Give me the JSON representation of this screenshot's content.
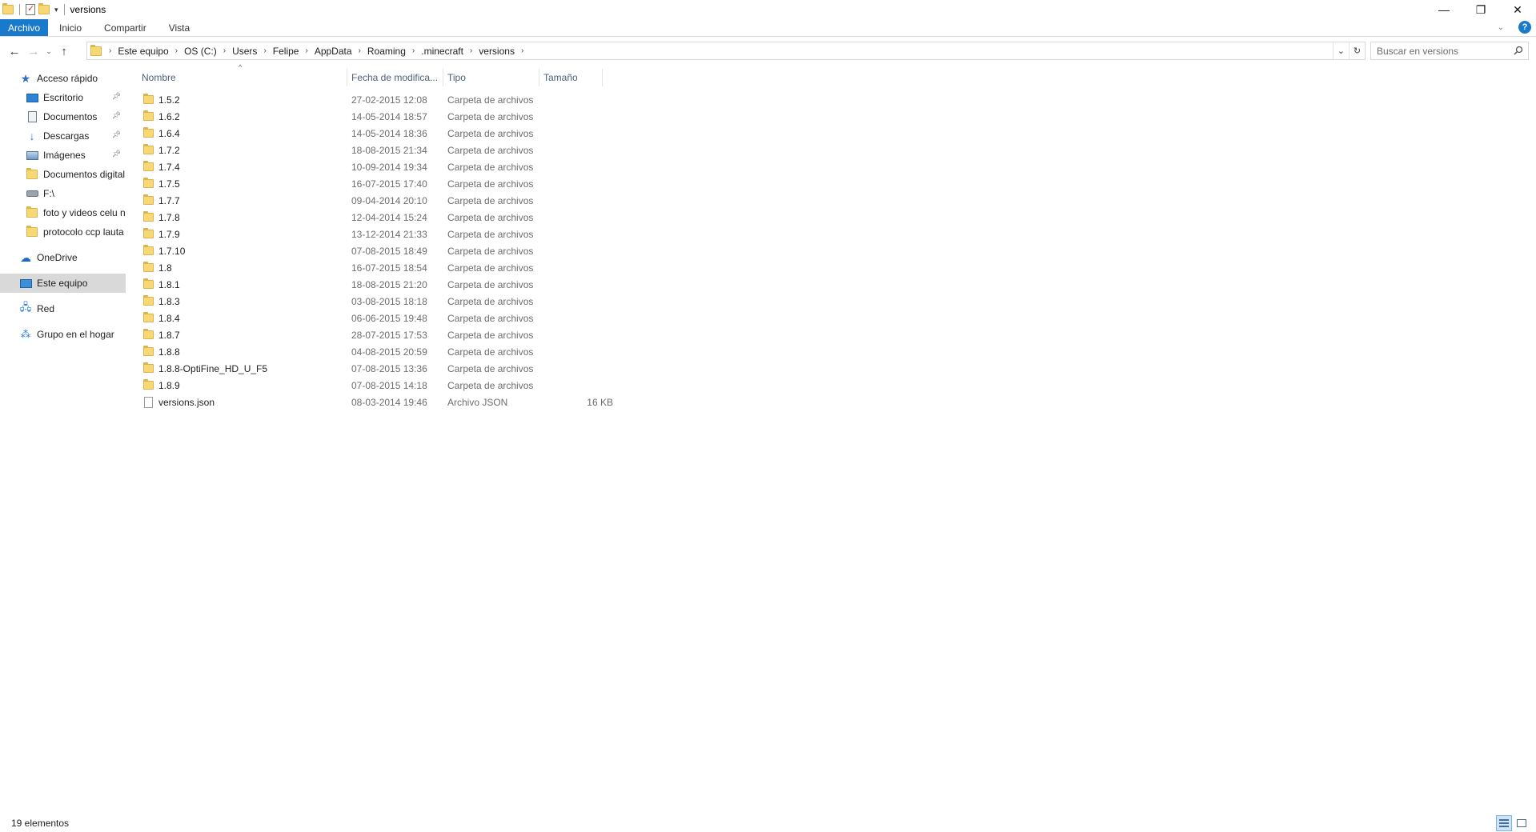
{
  "window": {
    "title": "versions",
    "controls": {
      "minimize": "—",
      "restore": "❐",
      "close": "✕"
    }
  },
  "ribbon": {
    "tabs": [
      "Archivo",
      "Inicio",
      "Compartir",
      "Vista"
    ],
    "help": "?"
  },
  "address": {
    "crumbs": [
      "Este equipo",
      "OS (C:)",
      "Users",
      "Felipe",
      "AppData",
      "Roaming",
      ".minecraft",
      "versions"
    ]
  },
  "search": {
    "placeholder": "Buscar en versions"
  },
  "sidebar": {
    "quick_access": "Acceso rápido",
    "quick_items": [
      {
        "label": "Escritorio",
        "icon": "desktop-icon",
        "pinned": true
      },
      {
        "label": "Documentos",
        "icon": "documents-icon",
        "pinned": true
      },
      {
        "label": "Descargas",
        "icon": "downloads-icon",
        "pinned": true
      },
      {
        "label": "Imágenes",
        "icon": "pictures-icon",
        "pinned": true
      },
      {
        "label": "Documentos digital",
        "icon": "folder-icon",
        "pinned": false
      },
      {
        "label": "F:\\",
        "icon": "drive-icon",
        "pinned": false
      },
      {
        "label": "foto y videos celu n",
        "icon": "folder-icon",
        "pinned": false
      },
      {
        "label": "protocolo ccp lauta",
        "icon": "folder-icon",
        "pinned": false
      }
    ],
    "onedrive": "OneDrive",
    "this_pc": "Este equipo",
    "network": "Red",
    "homegroup": "Grupo en el hogar"
  },
  "columns": {
    "name": "Nombre",
    "date": "Fecha de modifica...",
    "type": "Tipo",
    "size": "Tamaño"
  },
  "files": [
    {
      "name": "1.5.2",
      "date": "27-02-2015 12:08",
      "type": "Carpeta de archivos",
      "size": "",
      "kind": "folder"
    },
    {
      "name": "1.6.2",
      "date": "14-05-2014 18:57",
      "type": "Carpeta de archivos",
      "size": "",
      "kind": "folder"
    },
    {
      "name": "1.6.4",
      "date": "14-05-2014 18:36",
      "type": "Carpeta de archivos",
      "size": "",
      "kind": "folder"
    },
    {
      "name": "1.7.2",
      "date": "18-08-2015 21:34",
      "type": "Carpeta de archivos",
      "size": "",
      "kind": "folder"
    },
    {
      "name": "1.7.4",
      "date": "10-09-2014 19:34",
      "type": "Carpeta de archivos",
      "size": "",
      "kind": "folder"
    },
    {
      "name": "1.7.5",
      "date": "16-07-2015 17:40",
      "type": "Carpeta de archivos",
      "size": "",
      "kind": "folder"
    },
    {
      "name": "1.7.7",
      "date": "09-04-2014 20:10",
      "type": "Carpeta de archivos",
      "size": "",
      "kind": "folder"
    },
    {
      "name": "1.7.8",
      "date": "12-04-2014 15:24",
      "type": "Carpeta de archivos",
      "size": "",
      "kind": "folder"
    },
    {
      "name": "1.7.9",
      "date": "13-12-2014 21:33",
      "type": "Carpeta de archivos",
      "size": "",
      "kind": "folder"
    },
    {
      "name": "1.7.10",
      "date": "07-08-2015 18:49",
      "type": "Carpeta de archivos",
      "size": "",
      "kind": "folder"
    },
    {
      "name": "1.8",
      "date": "16-07-2015 18:54",
      "type": "Carpeta de archivos",
      "size": "",
      "kind": "folder"
    },
    {
      "name": "1.8.1",
      "date": "18-08-2015 21:20",
      "type": "Carpeta de archivos",
      "size": "",
      "kind": "folder"
    },
    {
      "name": "1.8.3",
      "date": "03-08-2015 18:18",
      "type": "Carpeta de archivos",
      "size": "",
      "kind": "folder"
    },
    {
      "name": "1.8.4",
      "date": "06-06-2015 19:48",
      "type": "Carpeta de archivos",
      "size": "",
      "kind": "folder"
    },
    {
      "name": "1.8.7",
      "date": "28-07-2015 17:53",
      "type": "Carpeta de archivos",
      "size": "",
      "kind": "folder"
    },
    {
      "name": "1.8.8",
      "date": "04-08-2015 20:59",
      "type": "Carpeta de archivos",
      "size": "",
      "kind": "folder"
    },
    {
      "name": "1.8.8-OptiFine_HD_U_F5",
      "date": "07-08-2015 13:36",
      "type": "Carpeta de archivos",
      "size": "",
      "kind": "folder"
    },
    {
      "name": "1.8.9",
      "date": "07-08-2015 14:18",
      "type": "Carpeta de archivos",
      "size": "",
      "kind": "folder"
    },
    {
      "name": "versions.json",
      "date": "08-03-2014 19:46",
      "type": "Archivo JSON",
      "size": "16 KB",
      "kind": "file"
    }
  ],
  "status": {
    "count": "19 elementos"
  },
  "colors": {
    "accent": "#1979ca",
    "folder": "#f8d775",
    "selected_nav": "#d9d9d9"
  }
}
